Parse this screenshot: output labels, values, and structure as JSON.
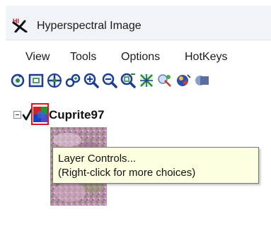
{
  "window": {
    "title": "Hyperspectral Image",
    "logo_text": "HI"
  },
  "menu": {
    "items": [
      "View",
      "Tools",
      "Options",
      "HotKeys"
    ]
  },
  "toolbar": {
    "tools": [
      {
        "icon": "refresh-tool-icon"
      },
      {
        "icon": "select-rectangle-icon"
      },
      {
        "icon": "pan-move-icon"
      },
      {
        "icon": "link-tool-icon"
      },
      {
        "icon": "zoom-in-icon"
      },
      {
        "icon": "zoom-out-icon"
      },
      {
        "icon": "zoom-fit-icon"
      },
      {
        "icon": "roi-tool-icon"
      },
      {
        "icon": "classify-tool-icon"
      },
      {
        "icon": "spectral-tool-icon"
      },
      {
        "icon": "overflow-tool-icon"
      }
    ]
  },
  "layer": {
    "name": "Cuprite97",
    "checked": true,
    "expanded": true
  },
  "tooltip": {
    "line1": "Layer Controls...",
    "line2": "(Right-click for more choices)"
  },
  "colors": {
    "highlight": "#e0141a",
    "tooltip_bg": "#ffffe1"
  }
}
